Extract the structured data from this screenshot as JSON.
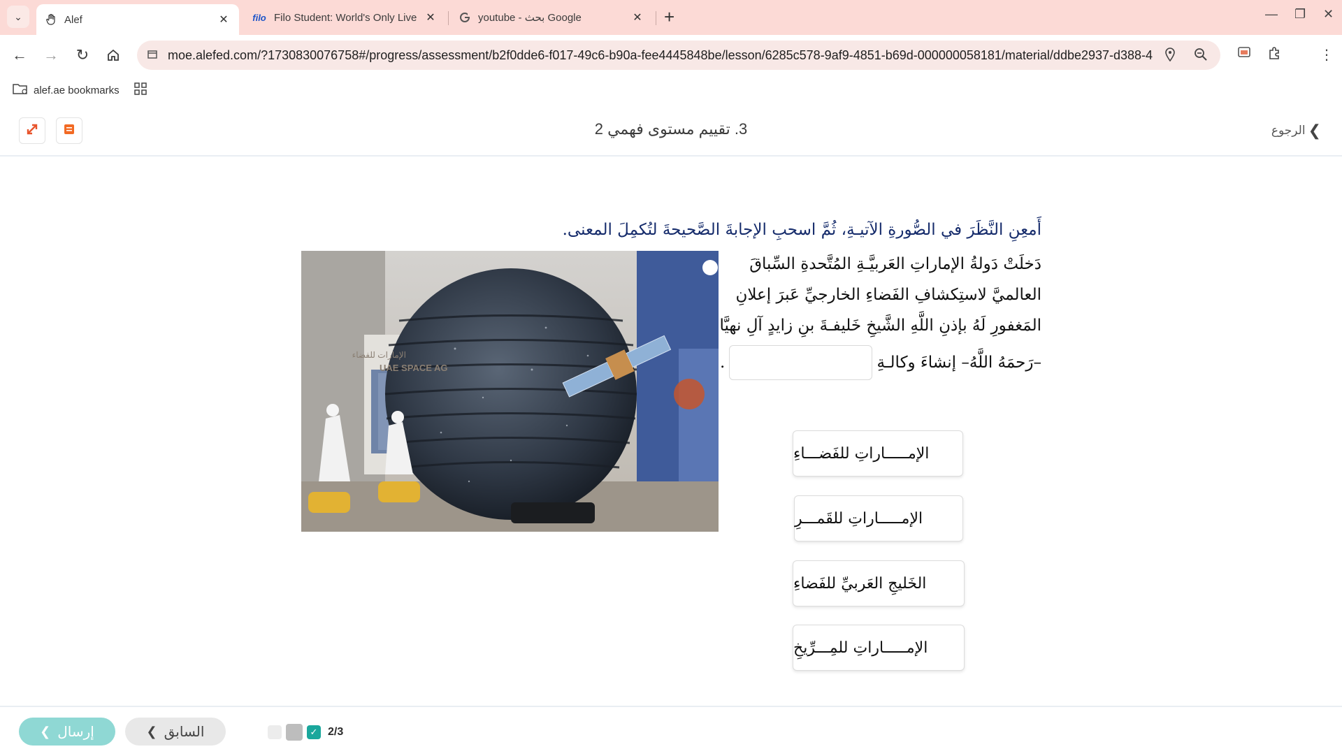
{
  "browser": {
    "tabs": [
      {
        "title": "Alef",
        "favicon": "hand-icon",
        "active": true
      },
      {
        "title": "Filo Student: World's Only Live I",
        "favicon_text": "filo",
        "active": false
      },
      {
        "title": "youtube - بحث Google",
        "favicon": "google-icon",
        "active": false
      }
    ],
    "url": "moe.alefed.com/?1730830076758#/progress/assessment/b2f0dde6-f017-49c6-b90a-fee4445848be/lesson/6285c578-9af9-4851-b69d-000000058181/material/ddbe2937-d388-4...",
    "bookmarks": {
      "folder_label": "alef.ae bookmarks"
    }
  },
  "header": {
    "title": "3. تقييم مستوى فهمي 2",
    "back_label": "الرجوع"
  },
  "question": {
    "instruction": "أَمعِنِ النَّظَرَ في الصُّورةِ الآتيـةِ، ثُمَّ اسحبِ الإجابةَ الصَّحيحةَ لتُكمِلَ المعنى.",
    "passage_lines": [
      "دَخلَتْ دَولةُ الإماراتِ العَربيَّـةِ المُتَّحدةِ السِّباقَ",
      "العالميَّ لاستِكشافِ الفَضاءِ الخارجيِّ عَبرَ إعلانِ",
      "المَغفورِ لَهُ بإذنِ اللَّهِ الشَّيخِ خَليفـةَ بنِ زايدٍ آلِ نهيَّانَ"
    ],
    "blank_line_prefix": "–رَحمَهُ اللَّهُ– إنشاءَ وكالـةِ",
    "blank_line_suffix": ".",
    "image_text": {
      "sign_ar": "الإمارات للفضاء",
      "sign_en": "UAE SPACE AG"
    },
    "choices": [
      "الإمـــــاراتِ للفَضـــاءِ",
      "الإمـــــاراتِ للقَمـــرِ",
      "الخَليجِ العَربيِّ للفَضاءِ",
      "الإمـــــاراتِ للمِـــرِّيخِ"
    ]
  },
  "footer": {
    "submit_label": "إرسال",
    "previous_label": "السابق",
    "progress": "2/3"
  },
  "colors": {
    "tabstrip": "#fcdad6",
    "instruction_text": "#152b6b",
    "submit": "#8fd8d4",
    "progress_check": "#1aa79c"
  }
}
